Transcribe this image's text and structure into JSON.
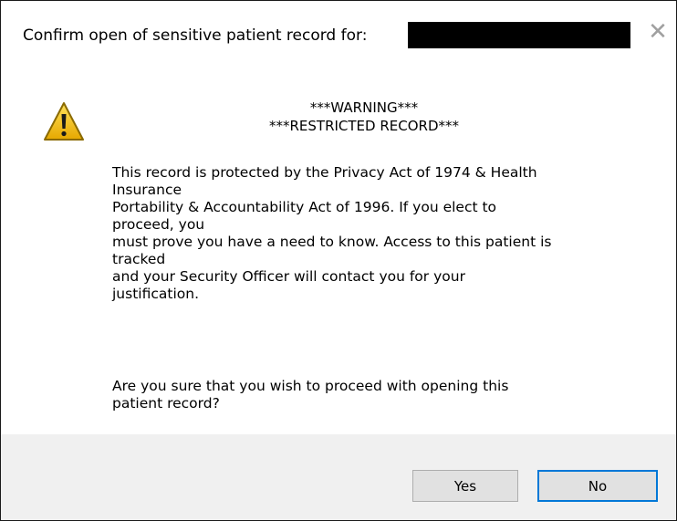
{
  "background": {
    "fragment_text": "‥ ‥‥ ‥ ‥‥‥‥‥"
  },
  "dialog": {
    "title": "Confirm open of sensitive patient record for:",
    "close_glyph": "✕"
  },
  "icon": {
    "name": "warning-icon"
  },
  "heading": {
    "line1": "***WARNING***",
    "line2": "***RESTRICTED RECORD***"
  },
  "body": {
    "lines": [
      "This record is protected by the Privacy Act of 1974 & Health",
      "Insurance",
      "Portability & Accountability Act of 1996. If you elect to",
      "proceed, you",
      "must prove you have a need to know.  Access to this patient is",
      "tracked",
      "and your Security Officer will contact you for your",
      "justification."
    ]
  },
  "question": {
    "lines": [
      "Are you sure that you wish to proceed with opening this",
      "patient record?"
    ]
  },
  "buttons": {
    "yes_label": "Yes",
    "no_label": "No"
  },
  "colors": {
    "footer_bg": "#f0f0f0",
    "button_bg": "#e1e1e1",
    "focus_border": "#0078d7",
    "warning_fill": "#f5c400"
  }
}
